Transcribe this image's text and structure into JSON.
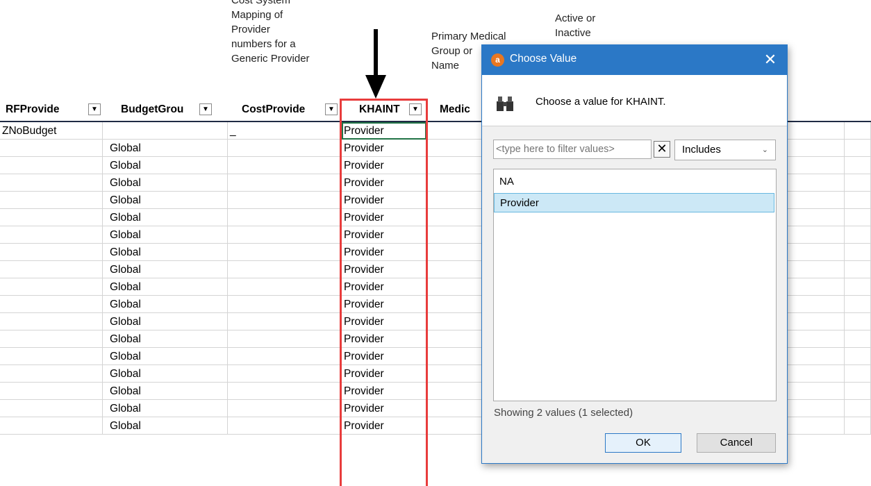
{
  "header_notes": {
    "cost_system": "Cost System\nMapping of\nProvider\nnumbers for a\nGeneric Provider",
    "primary_medical": "Primary Medical\nGroup or\nName",
    "active_inactive": "Active or\nInactive"
  },
  "columns": [
    {
      "label": "RFProvide",
      "id": "rfprovider"
    },
    {
      "label": "BudgetGrou",
      "id": "budgetgroup"
    },
    {
      "label": "CostProvide",
      "id": "costprovider"
    },
    {
      "label": "KHAINT",
      "id": "khaint"
    },
    {
      "label": "Medic",
      "id": "medical"
    }
  ],
  "rows": [
    {
      "rf": "ZNoBudget",
      "budget": "",
      "cost": "_",
      "khaint": "Provider"
    },
    {
      "rf": "",
      "budget": "Global",
      "cost": "",
      "khaint": "Provider"
    },
    {
      "rf": "",
      "budget": "Global",
      "cost": "",
      "khaint": "Provider"
    },
    {
      "rf": "",
      "budget": "Global",
      "cost": "",
      "khaint": "Provider"
    },
    {
      "rf": "",
      "budget": "Global",
      "cost": "",
      "khaint": "Provider"
    },
    {
      "rf": "",
      "budget": "Global",
      "cost": "",
      "khaint": "Provider"
    },
    {
      "rf": "",
      "budget": "Global",
      "cost": "",
      "khaint": "Provider"
    },
    {
      "rf": "",
      "budget": "Global",
      "cost": "",
      "khaint": "Provider"
    },
    {
      "rf": "",
      "budget": "Global",
      "cost": "",
      "khaint": "Provider"
    },
    {
      "rf": "",
      "budget": "Global",
      "cost": "",
      "khaint": "Provider"
    },
    {
      "rf": "",
      "budget": "Global",
      "cost": "",
      "khaint": "Provider"
    },
    {
      "rf": "",
      "budget": "Global",
      "cost": "",
      "khaint": "Provider"
    },
    {
      "rf": "",
      "budget": "Global",
      "cost": "",
      "khaint": "Provider"
    },
    {
      "rf": "",
      "budget": "Global",
      "cost": "",
      "khaint": "Provider"
    },
    {
      "rf": "",
      "budget": "Global",
      "cost": "",
      "khaint": "Provider"
    },
    {
      "rf": "",
      "budget": "Global",
      "cost": "",
      "khaint": "Provider"
    },
    {
      "rf": "",
      "budget": "Global",
      "cost": "",
      "khaint": "Provider"
    },
    {
      "rf": "",
      "budget": "Global",
      "cost": "",
      "khaint": "Provider"
    }
  ],
  "dialog": {
    "title": "Choose Value",
    "app_icon_letter": "a",
    "close_glyph": "✕",
    "prompt": "Choose a value for KHAINT.",
    "filter_placeholder": "<type here to filter values>",
    "filter_clear_glyph": "✕",
    "match_mode": "Includes",
    "values": [
      "NA",
      "Provider"
    ],
    "selected_value": "Provider",
    "status": "Showing 2 values (1 selected)",
    "ok_label": "OK",
    "cancel_label": "Cancel"
  },
  "colors": {
    "highlight_box": "#e83c3c",
    "dialog_titlebar": "#2b78c6",
    "selected_item": "#cce8f6"
  },
  "icons": {
    "arrow": "down-arrow-icon",
    "binoculars": "binoculars-icon",
    "dropdown": "dropdown-arrow-icon"
  }
}
